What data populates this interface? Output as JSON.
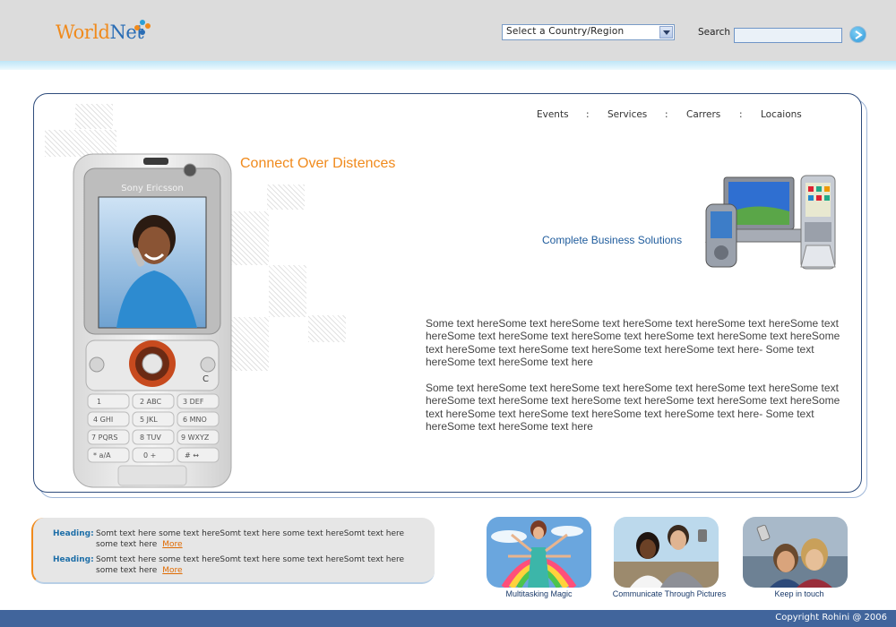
{
  "header": {
    "logo_text_a": "World",
    "logo_text_b": "Net",
    "country_select": {
      "selected": "Select a Country/Region"
    },
    "search_label": "Search",
    "search_value": ""
  },
  "nav": {
    "items": [
      "Events",
      "Services",
      "Carrers",
      "Locaions"
    ],
    "separator": ":"
  },
  "main": {
    "headline": "Connect Over Distences",
    "business_title": "Complete Business Solutions",
    "phone_brand": "Sony Ericsson",
    "paragraphs": [
      "Some text hereSome text hereSome text hereSome text hereSome text hereSome text hereSome text hereSome text hereSome text hereSome text hereSome text hereSome text hereSome text hereSome text hereSome text hereSome text here- Some text hereSome text hereSome text here",
      "Some text hereSome text hereSome text hereSome text hereSome text hereSome text hereSome text hereSome text hereSome text hereSome text hereSome text hereSome text hereSome text hereSome text hereSome text hereSome text here- Some text hereSome text hereSome text here"
    ]
  },
  "news": [
    {
      "heading": "Heading:",
      "text": "Somt text here some text hereSomt text here some text hereSomt text here some text here",
      "more": "More"
    },
    {
      "heading": "Heading:",
      "text": "Somt text here some text hereSomt text here some text hereSomt text here some text here",
      "more": "More"
    }
  ],
  "thumbnails": [
    {
      "caption": "Multitasking Magic"
    },
    {
      "caption": "Communicate Through Pictures"
    },
    {
      "caption": "Keep in touch"
    }
  ],
  "footer": {
    "copyright": "Copyright Rohini @ 2006"
  },
  "colors": {
    "accent_orange": "#f08a1c",
    "brand_blue": "#1e5b9c",
    "footer_blue": "#41659c",
    "header_gray": "#dcdcdc"
  },
  "icons": {
    "search_go": "arrow-right-circle-icon",
    "select_arrow": "chevron-down-icon"
  }
}
